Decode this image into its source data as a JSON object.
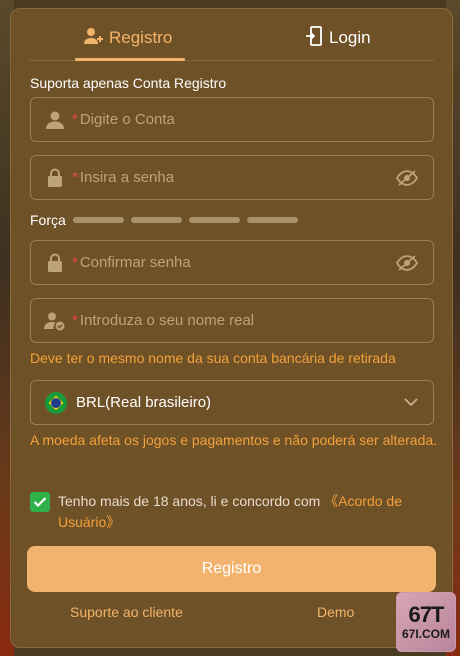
{
  "tabs": {
    "register": "Registro",
    "login": "Login"
  },
  "form": {
    "section_label": "Suporta apenas Conta Registro",
    "required_mark": "*",
    "account_placeholder": "Digite o Conta",
    "password_placeholder": "Insira a senha",
    "strength_label": "Força",
    "confirm_placeholder": "Confirmar senha",
    "realname_placeholder": "Introduza o seu nome real",
    "realname_hint": "Deve ter o mesmo nome da sua conta bancária de retirada",
    "currency_value": "BRL(Real brasileiro)",
    "currency_hint": "A moeda afeta os jogos e pagamentos e não poderá ser alterada.",
    "agree_text": "Tenho mais de 18 anos, li e concordo com ",
    "agree_link": "《Acordo de Usuário》",
    "agree_checked": true,
    "submit_label": "Registro"
  },
  "footer": {
    "support": "Suporte ao cliente",
    "demo": "Demo"
  },
  "badge": {
    "top": "67T",
    "bottom": "67I.COM"
  },
  "colors": {
    "accent": "#f2b46a",
    "warning": "#f2a23a",
    "panel": "#6f5128",
    "check": "#2fb14a"
  },
  "icons": {
    "register_tab": "user-plus-icon",
    "login_tab": "door-exit-icon",
    "account": "user-icon",
    "password": "lock-icon",
    "eye": "eye-off-icon",
    "realname": "user-check-icon",
    "currency": "brazil-flag-icon",
    "dropdown": "chevron-down-icon"
  }
}
